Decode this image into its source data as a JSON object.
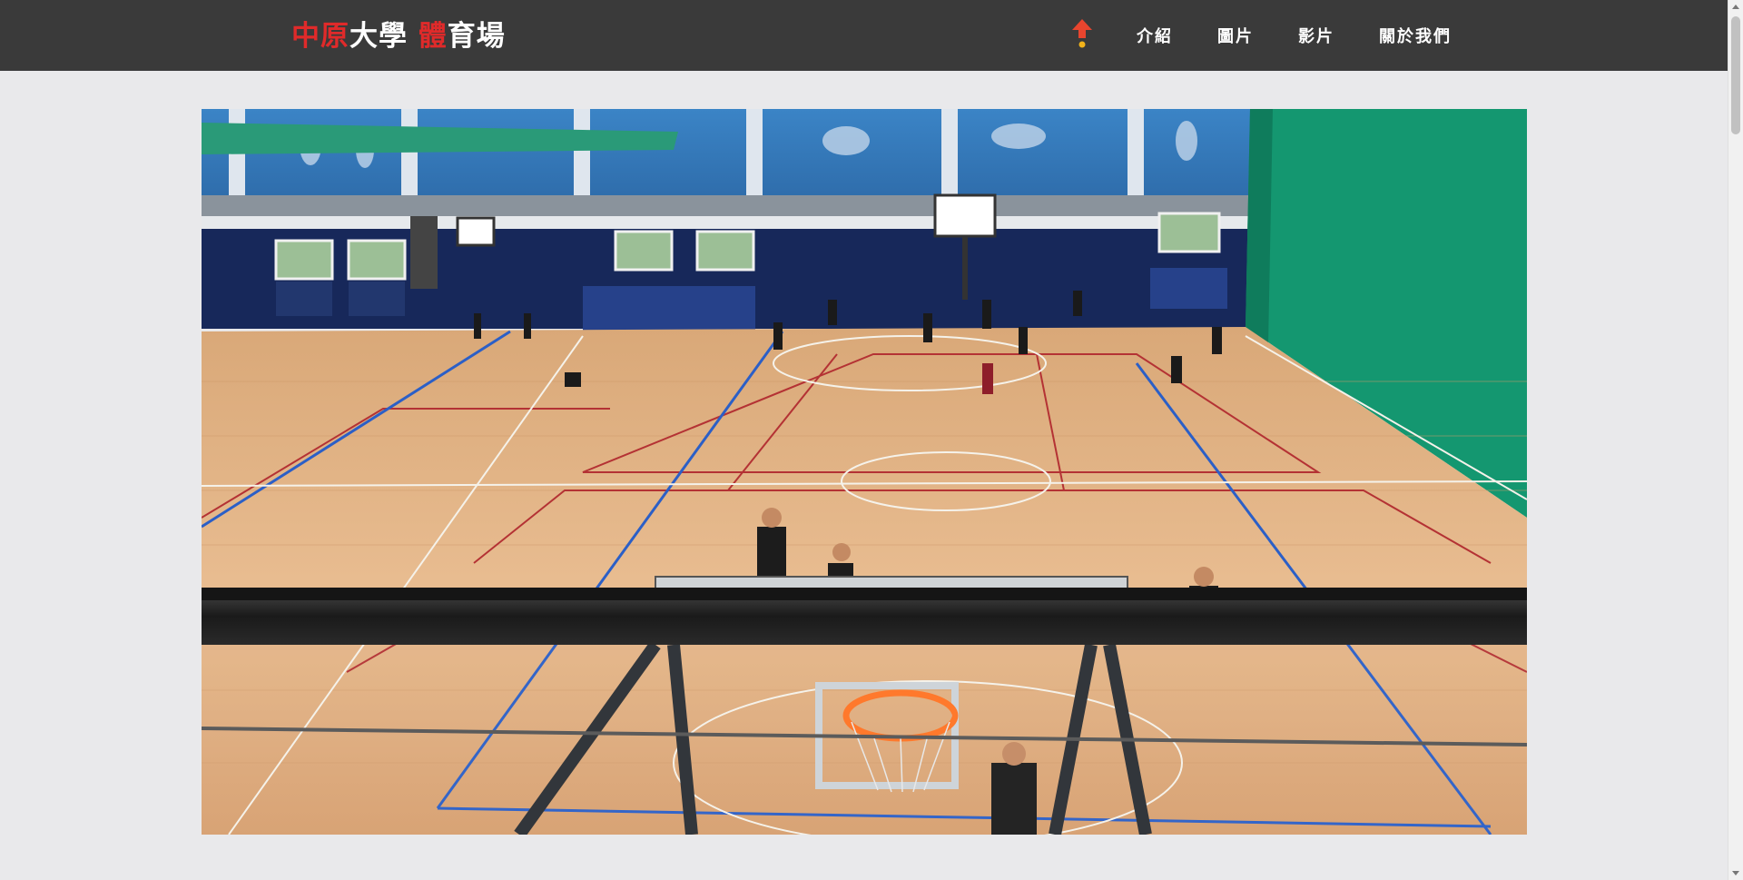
{
  "header": {
    "logo_parts": [
      "中原",
      "大學 ",
      "體",
      "育場"
    ],
    "nav": [
      {
        "label": "介紹"
      },
      {
        "label": "圖片"
      },
      {
        "label": "影片"
      },
      {
        "label": "關於我們"
      }
    ]
  },
  "icons": {
    "up": "arrow-up-icon"
  },
  "colors": {
    "header_bg": "#3a3a3a",
    "brand_red": "#e02a2a",
    "page_bg": "#e9e9eb"
  }
}
